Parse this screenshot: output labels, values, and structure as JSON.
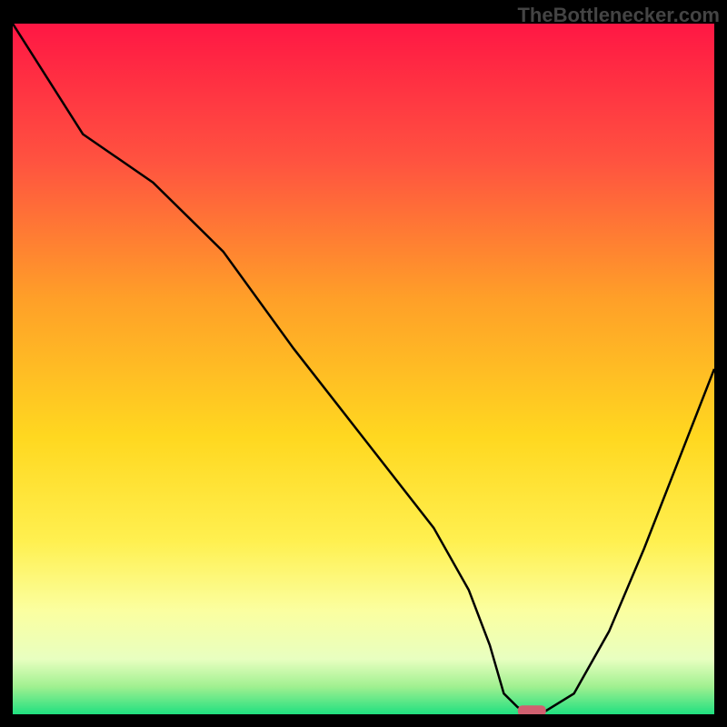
{
  "watermark": "TheBottleneсker.com",
  "chart_data": {
    "type": "line",
    "title": "",
    "xlabel": "",
    "ylabel": "",
    "xlim": [
      0,
      100
    ],
    "ylim": [
      0,
      100
    ],
    "series": [
      {
        "name": "curve",
        "x": [
          0,
          5,
          10,
          20,
          25,
          30,
          40,
          50,
          60,
          65,
          68,
          70,
          72,
          74,
          76,
          80,
          85,
          90,
          95,
          100
        ],
        "y": [
          100,
          92,
          84,
          77,
          72,
          67,
          53,
          40,
          27,
          18,
          10,
          3,
          1,
          0.5,
          0.5,
          3,
          12,
          24,
          37,
          50
        ]
      }
    ],
    "marker": {
      "x_start": 72,
      "x_end": 76,
      "y": 0.5,
      "color": "#d06070"
    },
    "gradient_stops": [
      {
        "offset": 0,
        "color": "#ff1744"
      },
      {
        "offset": 20,
        "color": "#ff5340"
      },
      {
        "offset": 40,
        "color": "#ffa028"
      },
      {
        "offset": 60,
        "color": "#ffd820"
      },
      {
        "offset": 75,
        "color": "#fff050"
      },
      {
        "offset": 85,
        "color": "#fbffa0"
      },
      {
        "offset": 92,
        "color": "#e8ffc0"
      },
      {
        "offset": 96,
        "color": "#a0f090"
      },
      {
        "offset": 100,
        "color": "#20e080"
      }
    ]
  }
}
